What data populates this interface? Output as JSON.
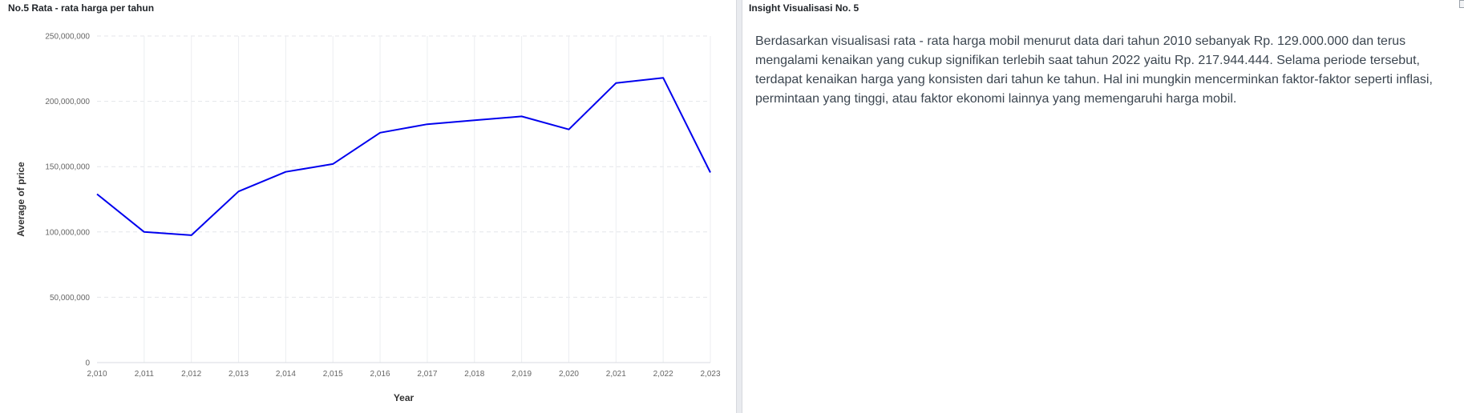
{
  "left_panel": {
    "title": "No.5 Rata - rata harga per tahun"
  },
  "right_panel": {
    "title": "Insight Visualisasi No. 5",
    "text": "Berdasarkan visualisasi rata - rata harga mobil menurut data dari tahun 2010 sebanyak Rp. 129.000.000 dan terus mengalami kenaikan yang cukup signifikan terlebih saat tahun 2022 yaitu Rp. 217.944.444. Selama periode tersebut, terdapat kenaikan harga yang konsisten dari tahun ke tahun. Hal ini mungkin mencerminkan faktor-faktor seperti inflasi, permintaan yang tinggi, atau faktor ekonomi lainnya yang memengaruhi harga mobil."
  },
  "chart_data": {
    "type": "line",
    "xlabel": "Year",
    "ylabel": "Average of price",
    "x": [
      "2,010",
      "2,011",
      "2,012",
      "2,013",
      "2,014",
      "2,015",
      "2,016",
      "2,017",
      "2,018",
      "2,019",
      "2,020",
      "2,021",
      "2,022",
      "2,023"
    ],
    "series": [
      {
        "color": "#0000ee",
        "values": [
          129000000,
          100000000,
          97500000,
          131000000,
          146000000,
          152000000,
          176000000,
          182500000,
          185500000,
          188500000,
          178500000,
          214000000,
          217944444,
          145500000
        ]
      }
    ],
    "ylim": [
      0,
      250000000
    ],
    "yticks": [
      "0",
      "50,000,000",
      "100,000,000",
      "150,000,000",
      "200,000,000",
      "250,000,000"
    ],
    "grid": true
  }
}
